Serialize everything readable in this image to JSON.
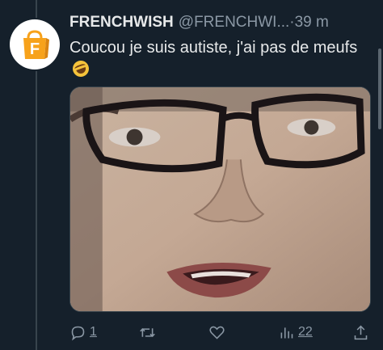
{
  "tweet": {
    "author_name": "FRENCHWISH",
    "author_handle": "@FRENCHWI...",
    "separator": "·",
    "time": "39 m",
    "text": "Coucou je suis autiste, j'ai pas de meufs",
    "emoji": "rolling-on-the-floor-laughing"
  },
  "avatar": {
    "letter": "F",
    "bag_color": "#f7a21b",
    "bg_color": "#ffffff"
  },
  "actions": {
    "reply_count": "1",
    "retweet_count": "",
    "like_count": "",
    "views_count": "22"
  },
  "colors": {
    "background": "#15202b",
    "text": "#e7e9ea",
    "secondary_text": "#8b98a5",
    "divider": "#38444d"
  }
}
